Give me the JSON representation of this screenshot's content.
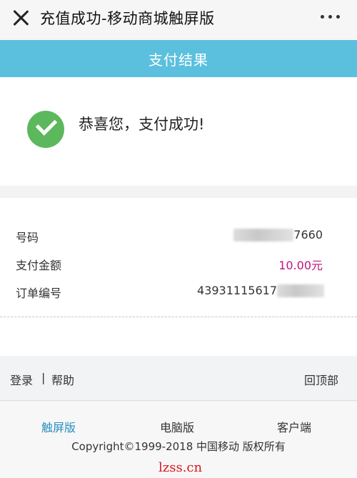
{
  "topbar": {
    "title": "充值成功-移动商城触屏版"
  },
  "header": {
    "title": "支付结果"
  },
  "result": {
    "message": "恭喜您，支付成功!"
  },
  "details": {
    "rows": [
      {
        "label": "号码",
        "value_suffix": "7660"
      },
      {
        "label": "支付金额",
        "value": "10.00元"
      },
      {
        "label": "订单编号",
        "value_prefix": "43931115617"
      }
    ]
  },
  "footer_nav": {
    "login": "登录",
    "separator": "|",
    "help": "帮助",
    "back_top": "回顶部"
  },
  "bottom": {
    "links": [
      "触屏版",
      "电脑版",
      "客户端"
    ],
    "copyright": "Copyright©1999-2018 中国移动 版权所有"
  },
  "watermark": "lzss.cn",
  "colors": {
    "header_bg": "#5bc0de",
    "success_green": "#5cb85c",
    "amount": "#c0157b",
    "active_link": "#2a8fc0"
  }
}
